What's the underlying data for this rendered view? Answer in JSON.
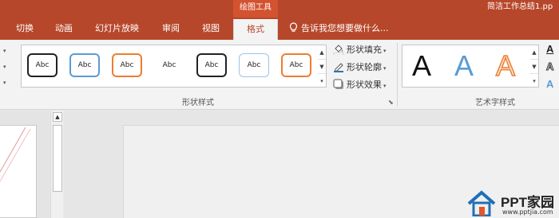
{
  "titlebar": {
    "context_tab": "绘图工具",
    "doc_title": "简洁工作总结1.pp"
  },
  "tabs": [
    {
      "label": "切换"
    },
    {
      "label": "动画"
    },
    {
      "label": "幻灯片放映"
    },
    {
      "label": "审阅"
    },
    {
      "label": "视图"
    },
    {
      "label": "格式",
      "active": true
    }
  ],
  "tell_me": "告诉我您想要做什么...",
  "shape_styles": {
    "items": [
      {
        "text": "Abc",
        "border": "#222222"
      },
      {
        "text": "Abc",
        "border": "#5b9bd5"
      },
      {
        "text": "Abc",
        "border": "#ed7d31"
      },
      {
        "text": "Abc",
        "border": "none"
      },
      {
        "text": "Abc",
        "border": "#222222"
      },
      {
        "text": "Abc",
        "border": "#9dc3e6"
      },
      {
        "text": "Abc",
        "border": "#ed7d31"
      }
    ],
    "commands": {
      "fill": "形状填充",
      "outline": "形状轮廓",
      "effects": "形状效果"
    },
    "group_label": "形状样式"
  },
  "wordart": {
    "items": [
      {
        "text": "A",
        "color": "#111111"
      },
      {
        "text": "A",
        "color": "#5b9bd5"
      },
      {
        "text": "A",
        "color": "#f4b183"
      }
    ],
    "group_label": "艺术字样式",
    "text_fill_letters": [
      "A",
      "A",
      "A"
    ]
  },
  "colors": {
    "accent": "#b7472a",
    "context_tab": "#d35230",
    "ribbon_bg": "#f3f3f3"
  },
  "watermark": {
    "text": "PPT家园",
    "url": "www.pptjia.com"
  }
}
